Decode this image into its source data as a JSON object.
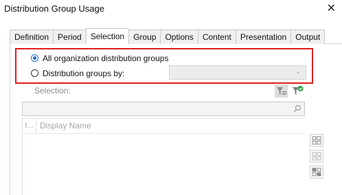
{
  "window": {
    "title": "Distribution Group Usage",
    "close_glyph": "✕"
  },
  "tabs": [
    {
      "label": "Definition",
      "active": false
    },
    {
      "label": "Period",
      "active": false
    },
    {
      "label": "Selection",
      "active": true
    },
    {
      "label": "Group",
      "active": false
    },
    {
      "label": "Options",
      "active": false
    },
    {
      "label": "Content",
      "active": false
    },
    {
      "label": "Presentation",
      "active": false
    },
    {
      "label": "Output",
      "active": false
    }
  ],
  "scope": {
    "option_all_label": "All organization distribution groups",
    "option_all_selected": true,
    "option_by_label": "Distribution groups by:",
    "option_by_selected": false,
    "by_combo_value": ""
  },
  "selection": {
    "label": "Selection:",
    "search_placeholder": "",
    "columns": [
      "I...",
      "Display Name"
    ]
  },
  "colors": {
    "highlight": "#e01c1c",
    "radio_accent": "#1b6fd1",
    "disabled_text": "#8b8b8b"
  }
}
